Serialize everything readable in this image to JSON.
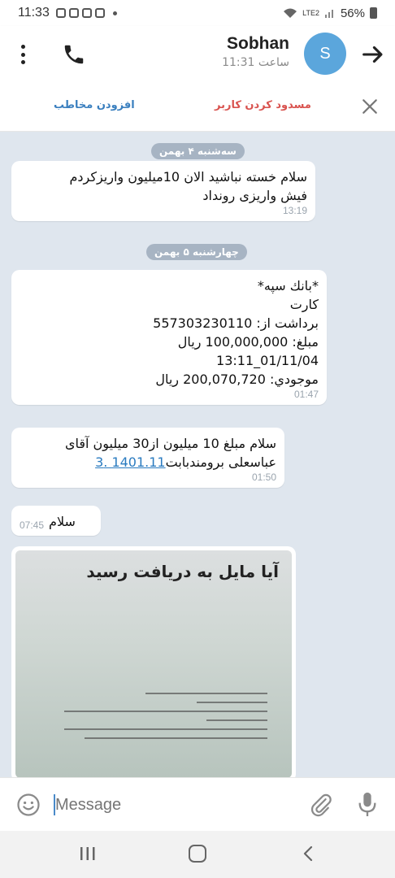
{
  "status_bar": {
    "time": "11:33",
    "network": "LTE2",
    "battery": "56%"
  },
  "header": {
    "name": "Sobhan",
    "last_seen": "ساعت 11:31",
    "avatar_letter": "S",
    "icons": [
      "more-vert-icon",
      "phone-icon",
      "arrow-right-icon"
    ],
    "avatar_color": "#5ba6dc"
  },
  "action_bar": {
    "add_contact": "افزودن مخاطب",
    "block_user": "مسدود کردن کاربر"
  },
  "chat": {
    "date_1": "سه‌شنبه ۴ بهمن",
    "date_2": "چهارشنبه ۵ بهمن",
    "messages": [
      {
        "text": "سلام خسته نباشید الان 10میلیون واریزکردم\nفیش واریزی روند‌اد",
        "time": "13:19"
      },
      {
        "text": "*بانك سپه*\nکارت\nبرداشت از: 557303230110\nمبلغ: 100,000,000 ريال\n01/11/04_13:11\nموجودي: 200,070,720 ريال",
        "time": "01:47"
      },
      {
        "text_prefix": "سلام مبلغ 10 میلیون از30 میلیون آقای\nعباسعلی برومندبابت",
        "link": "1401.11 .3",
        "time": "01:50"
      },
      {
        "text": "سلام",
        "time": "07:45"
      }
    ],
    "photo_caption": "آیا مایل به دریافت رسید"
  },
  "input_bar": {
    "placeholder": "Message",
    "icons": [
      "emoji-icon",
      "attach-icon",
      "mic-icon"
    ]
  },
  "nav_bar": {
    "icons": [
      "recent-apps-icon",
      "home-icon",
      "back-icon"
    ]
  }
}
